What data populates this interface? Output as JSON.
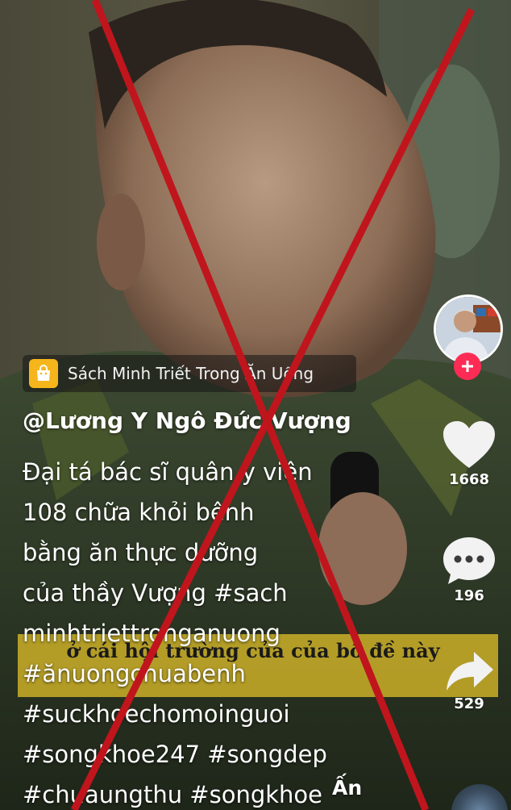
{
  "shop": {
    "label": "Sách Minh Triết Trong Ăn Uống"
  },
  "author": {
    "handle": "@Lương Y Ngô Đức Vượng"
  },
  "caption": {
    "lines": [
      "Đại tá bác sĩ quân y viện",
      "108 chữa khỏi bệnh",
      "bằng ăn thực dưỡng",
      "của thầy Vượng #sach",
      "minhtriettronganuong",
      "#ănuongchuabenh",
      "#suckhoechomoinguoi",
      "#songkhoe247 #songdep",
      "#chuaungthu #songkhoe"
    ],
    "more_label": "Ấn"
  },
  "subtitle": {
    "text": "ở cái hội trường của của bồ đề này"
  },
  "actions": {
    "likes": "1668",
    "comments": "196",
    "shares": "529"
  },
  "colors": {
    "cross": "#c0151d",
    "follow": "#fe2c55",
    "shop_icon": "#f5b51b",
    "subtitle_bg": "#d2b428"
  },
  "icons": [
    "shopping-bag-icon",
    "heart-icon",
    "comment-icon",
    "share-icon",
    "plus-icon",
    "music-disc-icon"
  ]
}
